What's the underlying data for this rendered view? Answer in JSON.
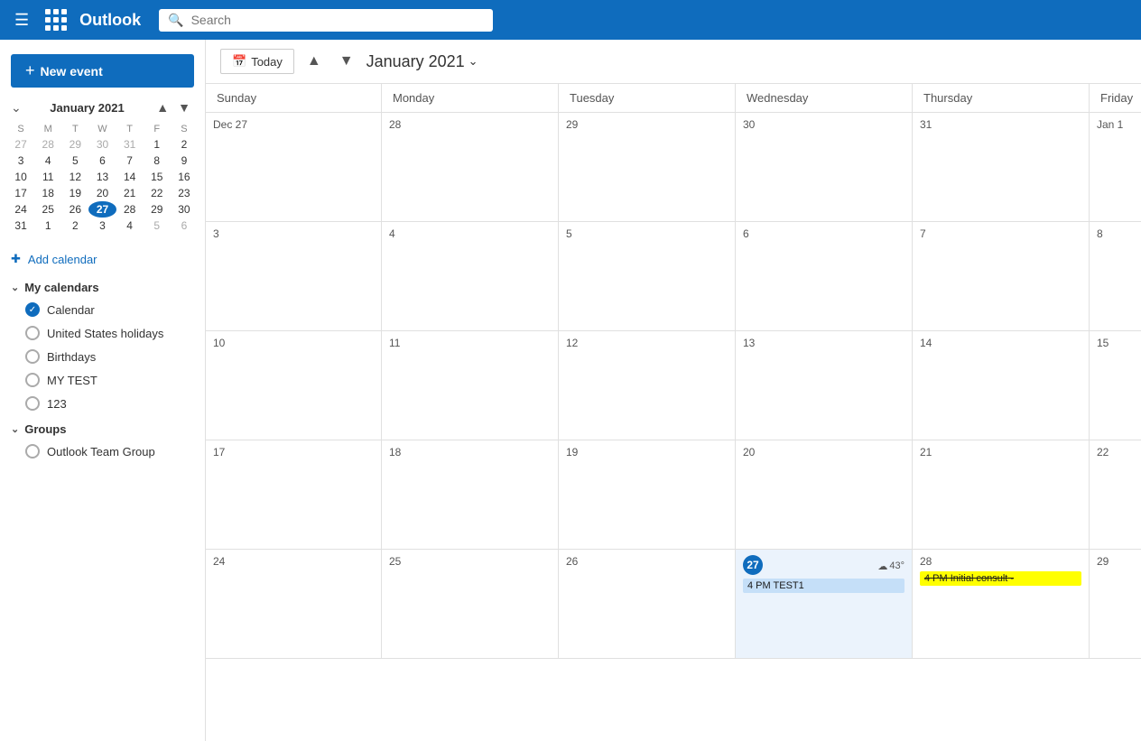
{
  "topbar": {
    "title": "Outlook",
    "search_placeholder": "Search"
  },
  "toolbar": {
    "today_label": "Today",
    "month_label": "January 2021"
  },
  "sidebar": {
    "new_event_label": "New event",
    "mini_cal_title": "January 2021",
    "mini_cal_days_header": [
      "S",
      "M",
      "T",
      "W",
      "T",
      "F",
      "S"
    ],
    "mini_cal_weeks": [
      [
        "27",
        "28",
        "29",
        "30",
        "31",
        "1",
        "2"
      ],
      [
        "3",
        "4",
        "5",
        "6",
        "7",
        "8",
        "9"
      ],
      [
        "10",
        "11",
        "12",
        "13",
        "14",
        "15",
        "16"
      ],
      [
        "17",
        "18",
        "19",
        "20",
        "21",
        "22",
        "23"
      ],
      [
        "24",
        "25",
        "26",
        "27",
        "28",
        "29",
        "30"
      ],
      [
        "31",
        "1",
        "2",
        "3",
        "4",
        "5",
        "6"
      ]
    ],
    "mini_cal_today_index": [
      4,
      3
    ],
    "add_calendar_label": "Add calendar",
    "my_calendars_label": "My calendars",
    "my_calendars": [
      {
        "name": "Calendar",
        "checked": true
      },
      {
        "name": "United States holidays",
        "checked": false
      },
      {
        "name": "Birthdays",
        "checked": false
      },
      {
        "name": "MY TEST",
        "checked": false
      },
      {
        "name": "123",
        "checked": false
      }
    ],
    "groups_label": "Groups",
    "groups": [
      {
        "name": "Outlook Team Group",
        "checked": false
      }
    ]
  },
  "week_headers": [
    "Sunday",
    "Monday",
    "Tuesday",
    "Wednesday",
    "Thursday",
    "Friday",
    ""
  ],
  "calendar": {
    "weeks": [
      {
        "cells": [
          {
            "day": "Dec 27",
            "type": "other"
          },
          {
            "day": "28",
            "type": "other"
          },
          {
            "day": "29",
            "type": "other"
          },
          {
            "day": "30",
            "type": "other"
          },
          {
            "day": "31",
            "type": "other"
          },
          {
            "day": "Jan 1",
            "type": "other"
          },
          {
            "day": "",
            "type": "overflow"
          }
        ]
      },
      {
        "cells": [
          {
            "day": "3",
            "type": "normal"
          },
          {
            "day": "4",
            "type": "normal"
          },
          {
            "day": "5",
            "type": "normal"
          },
          {
            "day": "6",
            "type": "normal"
          },
          {
            "day": "7",
            "type": "normal"
          },
          {
            "day": "8",
            "type": "normal"
          },
          {
            "day": "",
            "type": "overflow"
          }
        ]
      },
      {
        "cells": [
          {
            "day": "10",
            "type": "normal"
          },
          {
            "day": "11",
            "type": "normal"
          },
          {
            "day": "12",
            "type": "normal"
          },
          {
            "day": "13",
            "type": "normal"
          },
          {
            "day": "14",
            "type": "normal"
          },
          {
            "day": "15",
            "type": "normal"
          },
          {
            "day": "",
            "type": "overflow"
          }
        ]
      },
      {
        "cells": [
          {
            "day": "17",
            "type": "normal"
          },
          {
            "day": "18",
            "type": "normal"
          },
          {
            "day": "19",
            "type": "normal"
          },
          {
            "day": "20",
            "type": "normal"
          },
          {
            "day": "21",
            "type": "normal"
          },
          {
            "day": "22",
            "type": "normal"
          },
          {
            "day": "",
            "type": "overflow"
          }
        ]
      },
      {
        "cells": [
          {
            "day": "24",
            "type": "normal"
          },
          {
            "day": "25",
            "type": "normal"
          },
          {
            "day": "26",
            "type": "normal"
          },
          {
            "day": "27",
            "type": "today",
            "weather": "43°",
            "events": [
              {
                "label": "4 PM TEST1",
                "style": "blue"
              }
            ]
          },
          {
            "day": "28",
            "type": "normal",
            "weather": "",
            "events": [
              {
                "label": "4 PM Initial consult - ",
                "style": "yellow",
                "strikethrough": true
              }
            ]
          },
          {
            "day": "29",
            "type": "normal"
          },
          {
            "day": "",
            "type": "overflow"
          }
        ]
      }
    ]
  }
}
